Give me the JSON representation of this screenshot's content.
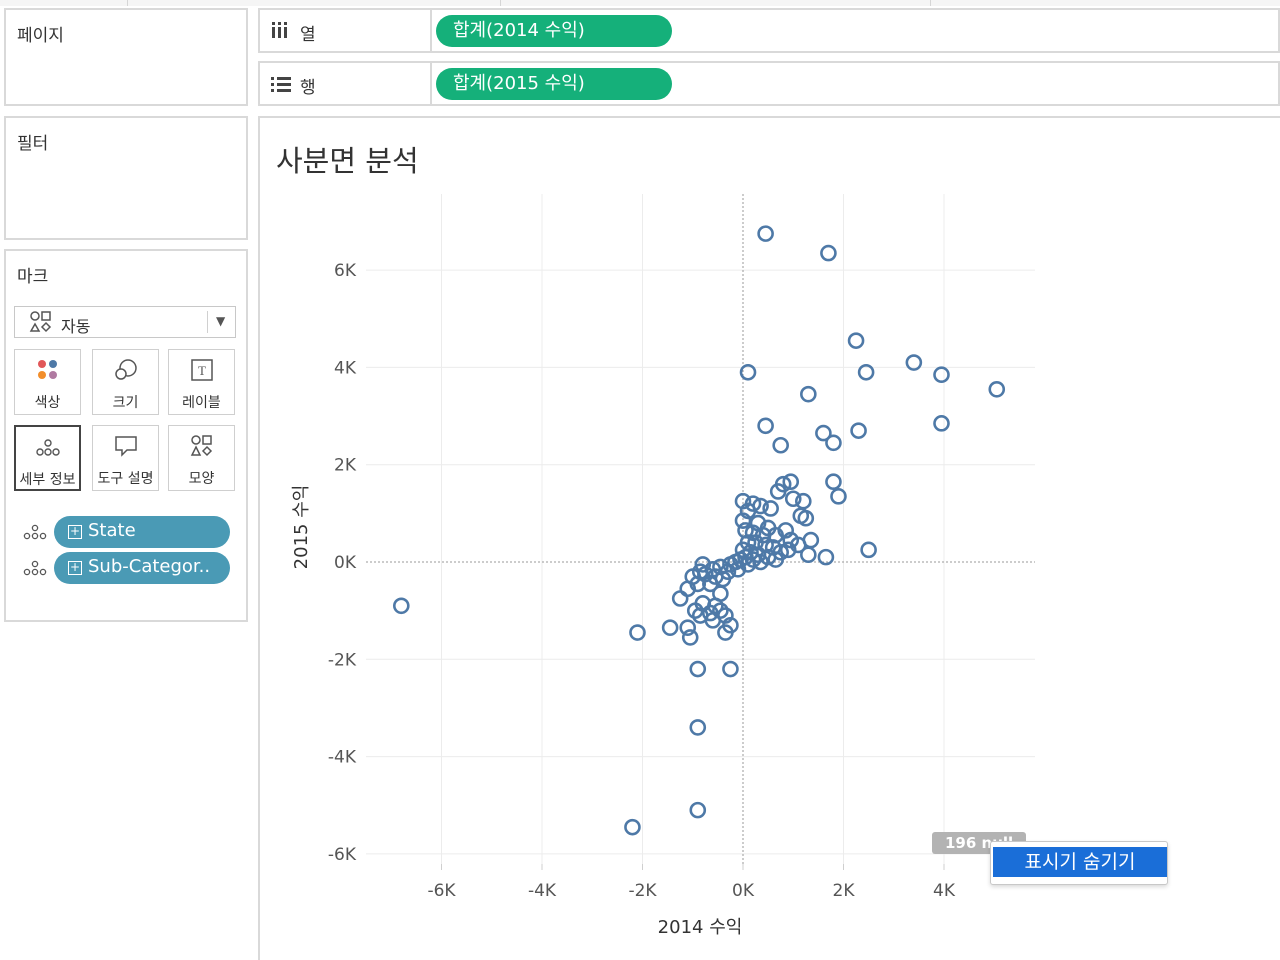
{
  "shelves": {
    "pages": {
      "label": "페이지"
    },
    "columns": {
      "label": "열",
      "icon": "columns-icon",
      "pill": "합계(2014 수익)"
    },
    "rows": {
      "label": "행",
      "icon": "rows-icon",
      "pill": "합계(2015 수익)"
    },
    "filters": {
      "label": "필터"
    }
  },
  "marks": {
    "label": "마크",
    "type_dropdown": {
      "value": "자동",
      "icon": "auto-mark-icon"
    },
    "buttons": [
      {
        "label": "색상",
        "icon": "color-icon"
      },
      {
        "label": "크기",
        "icon": "size-icon"
      },
      {
        "label": "레이블",
        "icon": "label-icon"
      },
      {
        "label": "세부 정보",
        "icon": "detail-icon",
        "active": true
      },
      {
        "label": "도구 설명",
        "icon": "tooltip-icon"
      },
      {
        "label": "모양",
        "icon": "shape-icon"
      }
    ],
    "fields": [
      {
        "name": "State",
        "icon": "detail-icon"
      },
      {
        "name": "Sub-Categor..",
        "icon": "detail-icon"
      }
    ]
  },
  "viz": {
    "title": "사분면 분석",
    "null_badge": "196 null",
    "popup_item": "표시기 숨기기"
  },
  "colors": {
    "pill_green": "#15b07a",
    "pill_blue": "#4a9ab5",
    "marker": "#4e79a7",
    "menu_highlight": "#1a6ed8"
  },
  "chart_data": {
    "type": "scatter",
    "title": "사분면 분석",
    "xlabel": "2014 수익",
    "ylabel": "2015 수익",
    "xlim": [
      -7500,
      5800
    ],
    "ylim": [
      -6700,
      7500
    ],
    "x_ticks": [
      "-6K",
      "-4K",
      "-2K",
      "0K",
      "2K",
      "4K"
    ],
    "x_tick_values": [
      -6000,
      -4000,
      -2000,
      0,
      2000,
      4000
    ],
    "y_ticks": [
      "6K",
      "4K",
      "2K",
      "0K",
      "-2K",
      "-4K",
      "-6K"
    ],
    "y_tick_values": [
      6000,
      4000,
      2000,
      0,
      -2000,
      -4000,
      -6000
    ],
    "grid": true,
    "marker": "hollow-circle",
    "points": [
      [
        450,
        6750
      ],
      [
        1700,
        6350
      ],
      [
        2250,
        4550
      ],
      [
        2450,
        3900
      ],
      [
        3400,
        4100
      ],
      [
        3950,
        3850
      ],
      [
        5050,
        3550
      ],
      [
        100,
        3900
      ],
      [
        1300,
        3450
      ],
      [
        450,
        2800
      ],
      [
        750,
        2400
      ],
      [
        1600,
        2650
      ],
      [
        1800,
        2450
      ],
      [
        2300,
        2700
      ],
      [
        3950,
        2850
      ],
      [
        1800,
        1650
      ],
      [
        1900,
        1350
      ],
      [
        2500,
        250
      ],
      [
        1650,
        100
      ],
      [
        950,
        1650
      ],
      [
        800,
        1600
      ],
      [
        700,
        1450
      ],
      [
        1000,
        1300
      ],
      [
        1200,
        1250
      ],
      [
        1250,
        900
      ],
      [
        1150,
        950
      ],
      [
        1350,
        450
      ],
      [
        1100,
        350
      ],
      [
        950,
        450
      ],
      [
        1300,
        150
      ],
      [
        900,
        250
      ],
      [
        0,
        1250
      ],
      [
        200,
        1200
      ],
      [
        350,
        1150
      ],
      [
        550,
        1100
      ],
      [
        100,
        1050
      ],
      [
        0,
        850
      ],
      [
        300,
        800
      ],
      [
        500,
        700
      ],
      [
        650,
        550
      ],
      [
        850,
        650
      ],
      [
        50,
        650
      ],
      [
        200,
        600
      ],
      [
        400,
        550
      ],
      [
        100,
        400
      ],
      [
        250,
        400
      ],
      [
        450,
        350
      ],
      [
        600,
        300
      ],
      [
        750,
        200
      ],
      [
        0,
        250
      ],
      [
        150,
        200
      ],
      [
        300,
        150
      ],
      [
        500,
        100
      ],
      [
        650,
        50
      ],
      [
        50,
        100
      ],
      [
        200,
        50
      ],
      [
        350,
        0
      ],
      [
        100,
        -50
      ],
      [
        -50,
        50
      ],
      [
        -150,
        0
      ],
      [
        -250,
        -50
      ],
      [
        -100,
        -150
      ],
      [
        -300,
        -200
      ],
      [
        -450,
        -100
      ],
      [
        -600,
        -150
      ],
      [
        -800,
        -50
      ],
      [
        -850,
        -200
      ],
      [
        -550,
        -300
      ],
      [
        -400,
        -350
      ],
      [
        -650,
        -450
      ],
      [
        -450,
        -650
      ],
      [
        -750,
        -250
      ],
      [
        -900,
        -450
      ],
      [
        -1000,
        -300
      ],
      [
        -800,
        -850
      ],
      [
        -650,
        -1050
      ],
      [
        -550,
        -900
      ],
      [
        -450,
        -1000
      ],
      [
        -350,
        -1100
      ],
      [
        -600,
        -1200
      ],
      [
        -250,
        -1300
      ],
      [
        -350,
        -1450
      ],
      [
        -850,
        -1100
      ],
      [
        -950,
        -1000
      ],
      [
        -1100,
        -550
      ],
      [
        -1250,
        -750
      ],
      [
        -1100,
        -1350
      ],
      [
        -1050,
        -1550
      ],
      [
        -1450,
        -1350
      ],
      [
        -2100,
        -1450
      ],
      [
        -900,
        -2200
      ],
      [
        -250,
        -2200
      ],
      [
        -900,
        -3400
      ],
      [
        -900,
        -5100
      ],
      [
        -2200,
        -5450
      ],
      [
        -6800,
        -900
      ]
    ]
  }
}
